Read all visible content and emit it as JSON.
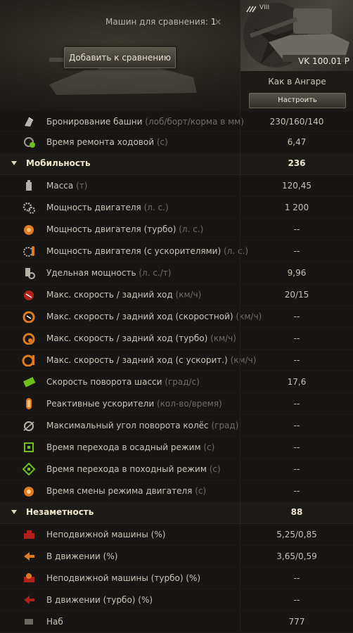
{
  "header": {
    "compare_label": "Машин для сравнения:",
    "compare_count": "1",
    "close_glyph": "×",
    "add_button": "Добавить к сравнению"
  },
  "tank": {
    "tier": "VIII",
    "name": "VK 100.01 P",
    "config": "Как в Ангаре",
    "tune_button": "Настроить"
  },
  "rows": [
    {
      "kind": "row",
      "icon": "turret-armor-icon",
      "label": "Бронирование башни",
      "unit": "(лоб/борт/корма в мм)",
      "value": "230/160/140"
    },
    {
      "kind": "row",
      "icon": "track-repair-icon",
      "label": "Время ремонта ходовой",
      "unit": "(с)",
      "value": "6,47"
    },
    {
      "kind": "section",
      "title": "Мобильность",
      "value": "236"
    },
    {
      "kind": "row",
      "icon": "weight-icon",
      "label": "Масса",
      "unit": "(т)",
      "value": "120,45"
    },
    {
      "kind": "row",
      "icon": "engine-power-icon",
      "label": "Мощность двигателя",
      "unit": "(л. с.)",
      "value": "1 200"
    },
    {
      "kind": "row",
      "icon": "engine-turbo-icon",
      "label": "Мощность двигателя (турбо)",
      "unit": "(л. с.)",
      "value": "--"
    },
    {
      "kind": "row",
      "icon": "engine-boost-icon",
      "label": "Мощность двигателя (с ускорителями)",
      "unit": "(л. с.)",
      "value": "--"
    },
    {
      "kind": "row",
      "icon": "specific-power-icon",
      "label": "Удельная мощность",
      "unit": "(л. с./т)",
      "value": "9,96"
    },
    {
      "kind": "row",
      "icon": "speed-icon",
      "label": "Макс. скорость / задний ход",
      "unit": "(км/ч)",
      "value": "20/15"
    },
    {
      "kind": "row",
      "icon": "speed-fast-icon",
      "label": "Макс. скорость / задний ход (скоростной)",
      "unit": "(км/ч)",
      "value": "--"
    },
    {
      "kind": "row",
      "icon": "speed-turbo-icon",
      "label": "Макс. скорость / задний ход (турбо)",
      "unit": "(км/ч)",
      "value": "--"
    },
    {
      "kind": "row",
      "icon": "speed-boost-icon",
      "label": "Макс. скорость / задний ход (с ускорит.)",
      "unit": "(км/ч)",
      "value": "--"
    },
    {
      "kind": "row",
      "icon": "hull-traverse-icon",
      "label": "Скорость поворота шасси",
      "unit": "(град/с)",
      "value": "17,6"
    },
    {
      "kind": "row",
      "icon": "rocket-booster-icon",
      "label": "Реактивные ускорители",
      "unit": "(кол-во/время)",
      "value": "--"
    },
    {
      "kind": "row",
      "icon": "wheel-angle-icon",
      "label": "Максимальный угол поворота колёс",
      "unit": "(град)",
      "value": "--"
    },
    {
      "kind": "row",
      "icon": "siege-mode-icon",
      "label": "Время перехода в осадный режим",
      "unit": " (с)",
      "value": "--"
    },
    {
      "kind": "row",
      "icon": "travel-mode-icon",
      "label": "Время перехода в походный режим",
      "unit": " (с)",
      "value": "--"
    },
    {
      "kind": "row",
      "icon": "engine-mode-icon",
      "label": "Время смены режима двигателя",
      "unit": "(с)",
      "value": "--"
    },
    {
      "kind": "section",
      "title": "Незаметность",
      "value": "88"
    },
    {
      "kind": "row",
      "icon": "camo-stationary-icon",
      "label": "Неподвижной машины (%)",
      "unit": "",
      "value": "5,25/0,85"
    },
    {
      "kind": "row",
      "icon": "camo-moving-icon",
      "label": "В движении (%)",
      "unit": "",
      "value": "3,65/0,59"
    },
    {
      "kind": "row",
      "icon": "camo-stationary-turbo-icon",
      "label": "Неподвижной машины (турбо) (%)",
      "unit": "",
      "value": "--"
    },
    {
      "kind": "row",
      "icon": "camo-moving-turbo-icon",
      "label": "В движении (турбо) (%)",
      "unit": "",
      "value": "--"
    },
    {
      "kind": "row",
      "icon": "next-icon",
      "label": "Наб",
      "unit": "",
      "value": "777"
    }
  ],
  "colors": {
    "accent": "#efe8cf",
    "orange": "#e07a1e",
    "green": "#6ec11a",
    "red": "#b3201a"
  }
}
